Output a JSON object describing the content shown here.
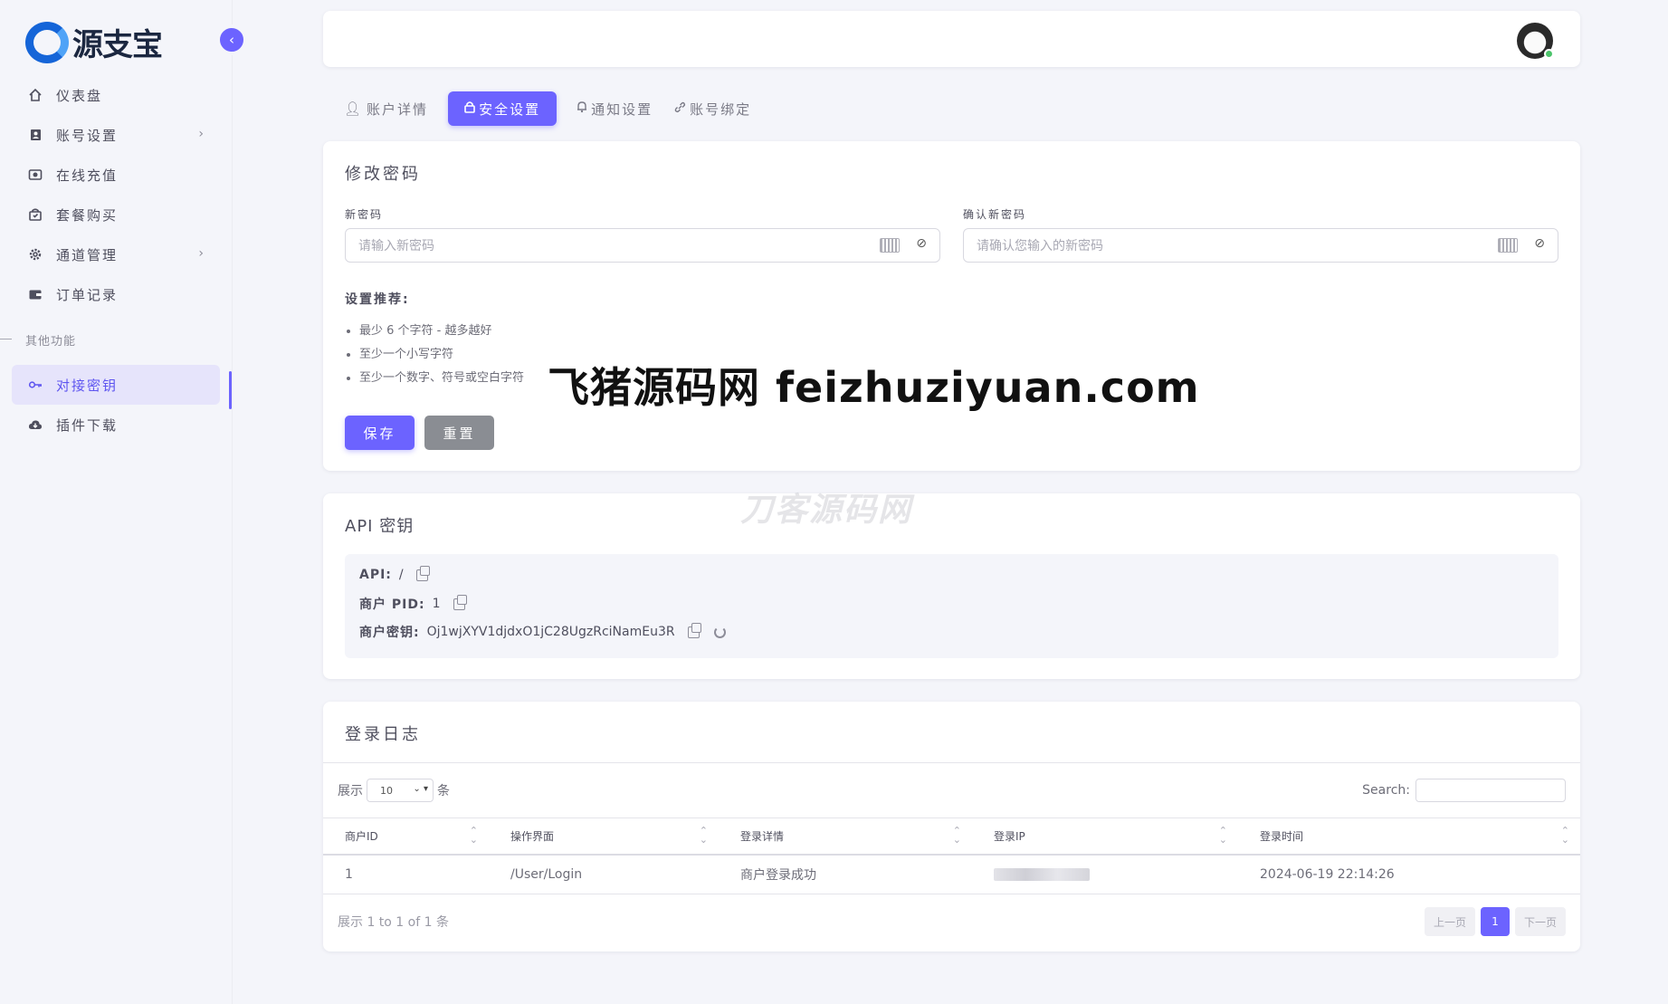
{
  "brand": {
    "logo_text": "源支宝"
  },
  "sidebar": {
    "items": [
      {
        "label": "仪表盘",
        "icon": "home-icon"
      },
      {
        "label": "账号设置",
        "icon": "user-card-icon",
        "has_submenu": true
      },
      {
        "label": "在线充值",
        "icon": "camera-icon"
      },
      {
        "label": "套餐购买",
        "icon": "shopping-bag-icon"
      },
      {
        "label": "通道管理",
        "icon": "gear-icon",
        "has_submenu": true
      },
      {
        "label": "订单记录",
        "icon": "wallet-icon"
      }
    ],
    "section_label": "其他功能",
    "extra_items": [
      {
        "label": "对接密钥",
        "icon": "key-icon",
        "active": true
      },
      {
        "label": "插件下载",
        "icon": "cloud-download-icon"
      }
    ]
  },
  "tabs": [
    {
      "label": "账户详情",
      "icon": "user-icon"
    },
    {
      "label": "安全设置",
      "icon": "lock-icon",
      "active": true
    },
    {
      "label": "通知设置",
      "icon": "bell-icon"
    },
    {
      "label": "账号绑定",
      "icon": "link-icon"
    }
  ],
  "password": {
    "title": "修改密码",
    "new_label": "新密码",
    "new_placeholder": "请输入新密码",
    "confirm_label": "确认新密码",
    "confirm_placeholder": "请确认您输入的新密码",
    "tips_title": "设置推荐:",
    "tips": [
      "最少 6 个字符 - 越多越好",
      "至少一个小写字符",
      "至少一个数字、符号或空白字符"
    ],
    "save_label": "保存",
    "reset_label": "重置"
  },
  "api": {
    "title": "API 密钥",
    "api_label": "API:",
    "api_value": "/",
    "pid_label": "商户 PID:",
    "pid_value": "1",
    "key_label": "商户密钥:",
    "key_value": "Oj1wjXYV1djdxO1jC28UgzRciNamEu3R"
  },
  "login_log": {
    "title": "登录日志",
    "show_prefix": "展示",
    "page_size": "10",
    "show_suffix": "条",
    "search_label": "Search:",
    "columns": [
      "商户ID",
      "操作界面",
      "登录详情",
      "登录IP",
      "登录时间"
    ],
    "rows": [
      {
        "id": "1",
        "page": "/User/Login",
        "detail": "商户登录成功",
        "time": "2024-06-19 22:14:26"
      }
    ],
    "info": "展示 1 to 1 of 1 条",
    "prev_label": "上一页",
    "current_page": "1",
    "next_label": "下一页"
  },
  "watermarks": {
    "main": "飞猪源码网 feizhuziyuan.com",
    "faint": "刀客源码网"
  },
  "colors": {
    "accent": "#6c63ff",
    "reset_button": "#8a8d93",
    "online": "#4cc46b"
  }
}
